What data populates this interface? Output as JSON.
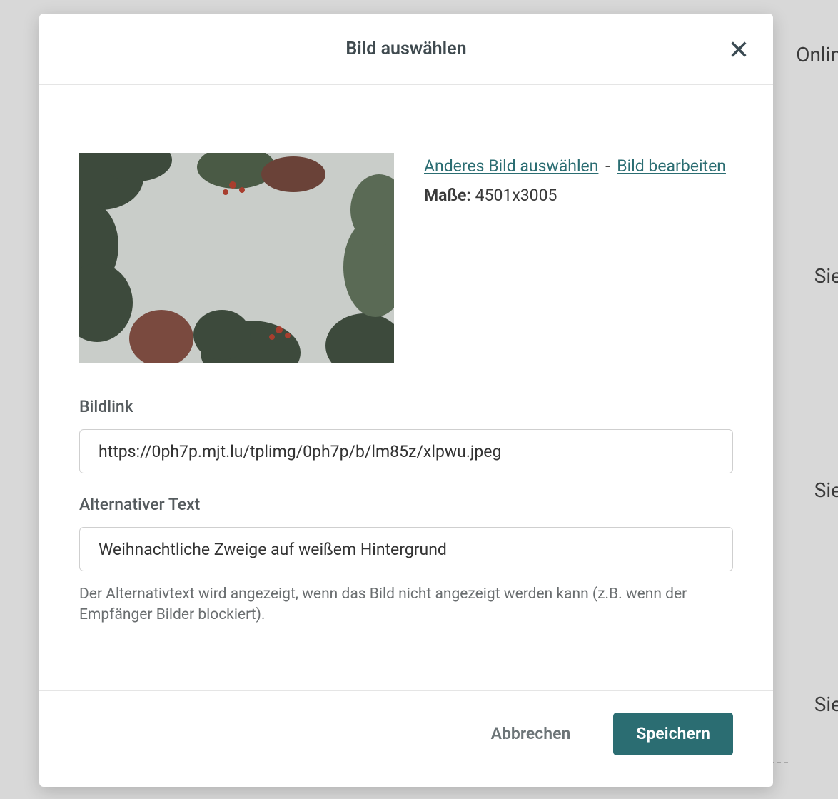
{
  "modal": {
    "title": "Bild auswählen",
    "links": {
      "choose_other": "Anderes Bild auswählen",
      "edit": "Bild bearbeiten",
      "separator": "-"
    },
    "dimensions": {
      "label": "Maße:",
      "value": "4501x3005"
    },
    "fields": {
      "link": {
        "label": "Bildlink",
        "value": "https://0ph7p.mjt.lu/tplimg/0ph7p/b/lm85z/xlpwu.jpeg"
      },
      "alt": {
        "label": "Alternativer Text",
        "value": "Weihnachtliche Zweige auf weißem Hintergrund",
        "help": "Der Alternativtext wird angezeigt, wenn das Bild nicht angezeigt werden kann (z.B. wenn der Empfänger Bilder blockiert)."
      }
    },
    "footer": {
      "cancel": "Abbrechen",
      "save": "Speichern"
    }
  },
  "background": {
    "text1": "Onlin",
    "text2": "Sie",
    "text3": "Sie",
    "text4": "Sie"
  }
}
